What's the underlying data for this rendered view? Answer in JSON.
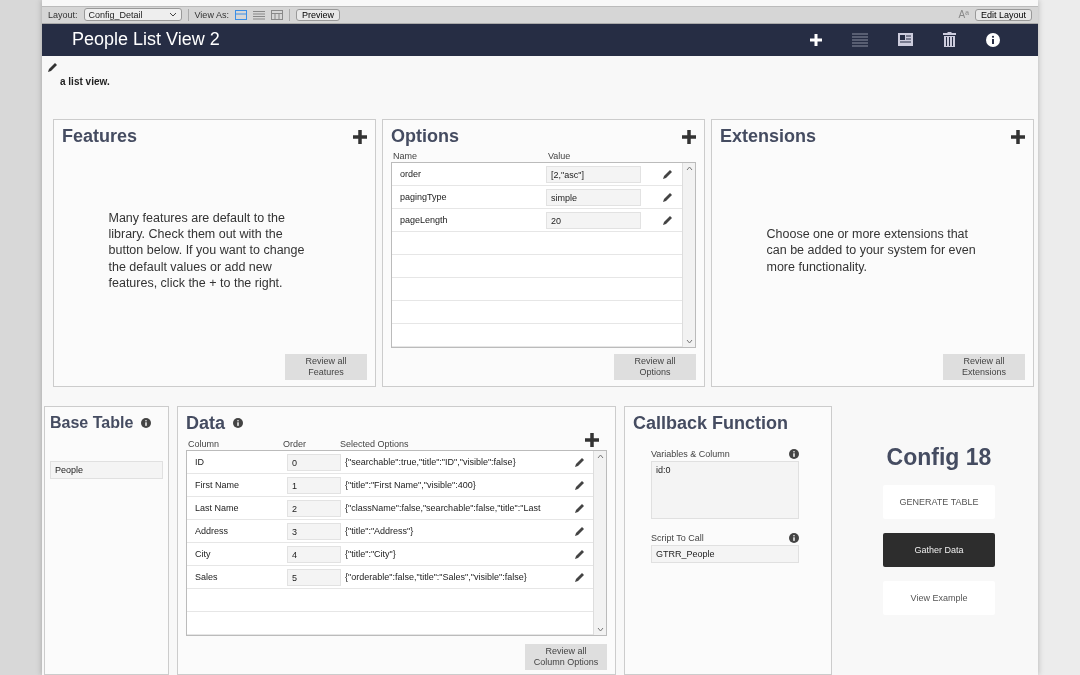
{
  "toolbar": {
    "layout_label": "Layout:",
    "layout_value": "Config_Detail",
    "view_as_label": "View As:",
    "view_modes": [
      {
        "kind": "form",
        "selected": true
      },
      {
        "kind": "list",
        "selected": false
      },
      {
        "kind": "table",
        "selected": false
      }
    ],
    "preview_button": "Preview",
    "text_size_icon": "Aª",
    "edit_layout_button": "Edit Layout"
  },
  "header": {
    "title": "People List View 2"
  },
  "description": "a list view.",
  "features": {
    "title": "Features",
    "text": "Many features are default to the library. Check them out with the button below. If you want to change the default values or add new features, click the + to the right.",
    "button": "Review all Features"
  },
  "options": {
    "title": "Options",
    "columns": [
      "Name",
      "Value"
    ],
    "rows": [
      {
        "name": "order",
        "value": "[2,\"asc\"]"
      },
      {
        "name": "pagingType",
        "value": "simple"
      },
      {
        "name": "pageLength",
        "value": "20"
      }
    ],
    "button": "Review all Options"
  },
  "extensions": {
    "title": "Extensions",
    "text": "Choose one or more extensions that can be added to your system for even more functionality.",
    "button": "Review all Extensions"
  },
  "base_table": {
    "title": "Base Table",
    "value": "People"
  },
  "data": {
    "title": "Data",
    "columns": [
      "Column",
      "Order",
      "Selected Options"
    ],
    "rows": [
      {
        "column": "ID",
        "order": "0",
        "options": "{\"searchable\":true,\"title\":\"ID\",\"visible\":false}"
      },
      {
        "column": "First Name",
        "order": "1",
        "options": "{\"title\":\"First Name\",\"visible\":400}"
      },
      {
        "column": "Last Name",
        "order": "2",
        "options": "{\"className\":false,\"searchable\":false,\"title\":\"Last"
      },
      {
        "column": "Address",
        "order": "3",
        "options": "{\"title\":\"Address\"}"
      },
      {
        "column": "City",
        "order": "4",
        "options": "{\"title\":\"City\"}"
      },
      {
        "column": "Sales",
        "order": "5",
        "options": "{\"orderable\":false,\"title\":\"Sales\",\"visible\":false}"
      }
    ],
    "button": "Review all Column Options"
  },
  "callback": {
    "title": "Callback Function",
    "variables_label": "Variables & Column",
    "variables_value": "id:0",
    "script_label": "Script To Call",
    "script_value": "GTRR_People"
  },
  "config": {
    "title": "Config 18",
    "buttons": [
      {
        "label": "GENERATE TABLE",
        "kind": "light"
      },
      {
        "label": "Gather Data",
        "kind": "dark"
      },
      {
        "label": "View Example",
        "kind": "light"
      }
    ]
  }
}
